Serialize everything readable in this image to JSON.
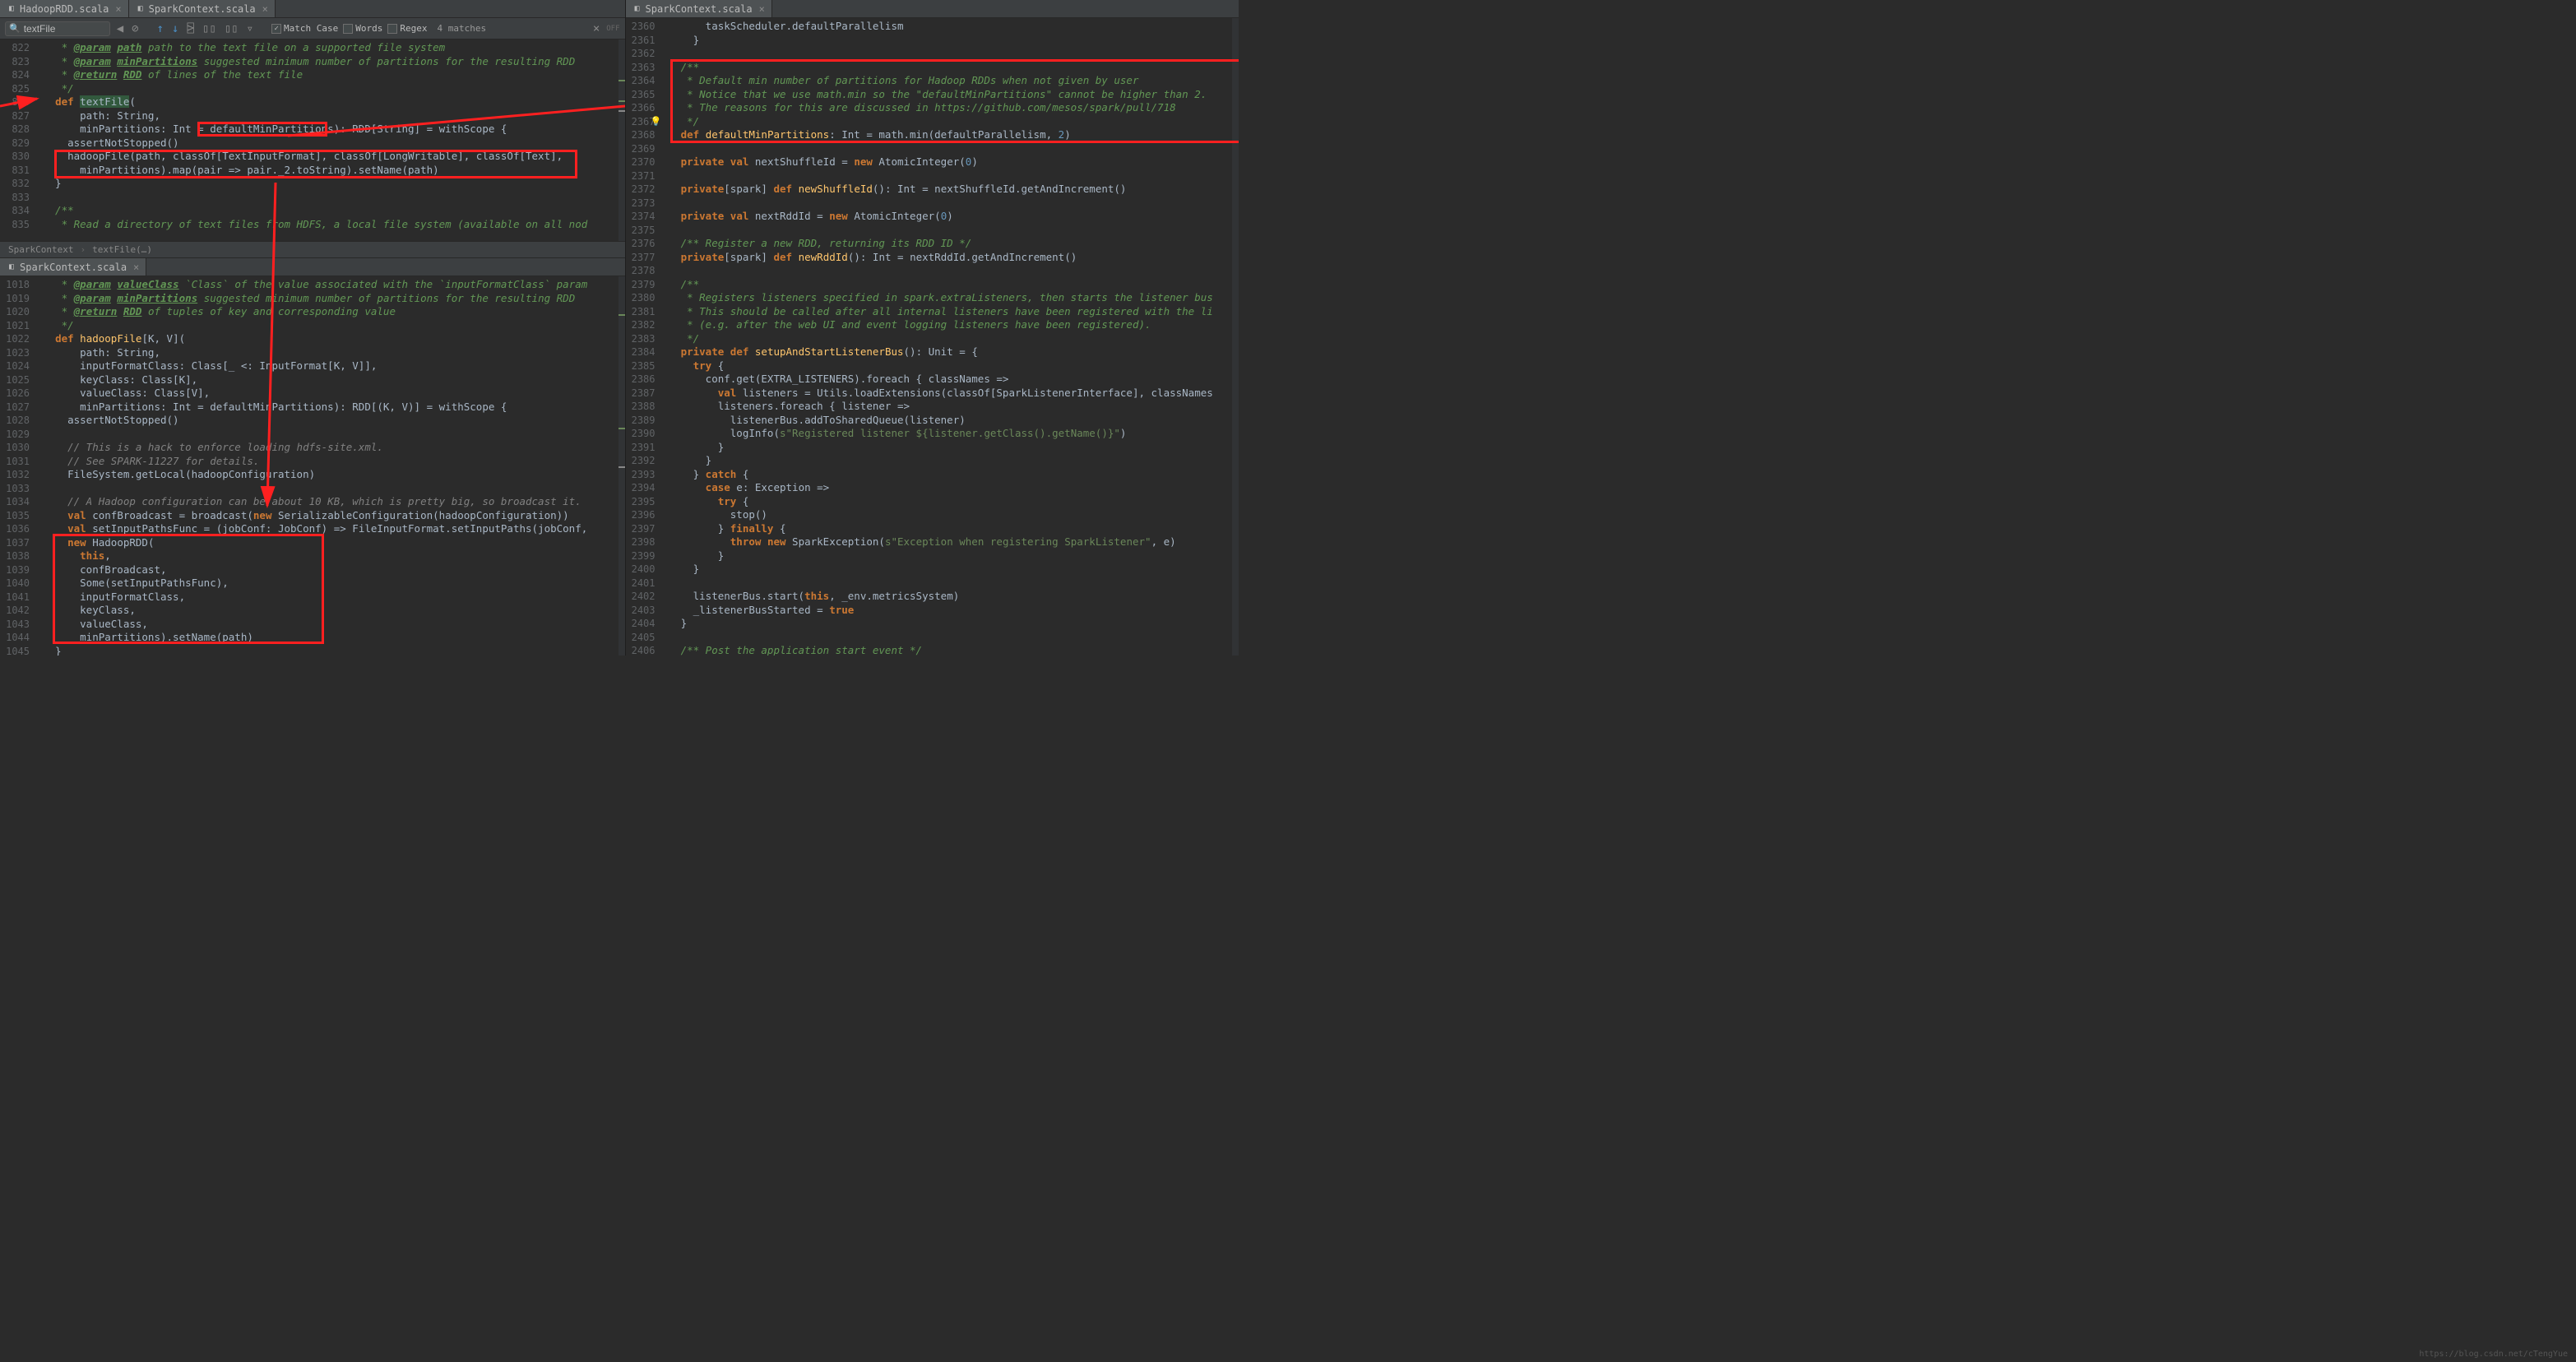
{
  "tabs_top_left": [
    {
      "name": "HadoopRDD.scala",
      "icon": "🟥"
    },
    {
      "name": "SparkContext.scala",
      "icon": "🟥"
    }
  ],
  "tabs_top_right": [
    {
      "name": "SparkContext.scala",
      "icon": "🟥"
    }
  ],
  "tabs_mid": [
    {
      "name": "SparkContext.scala",
      "icon": "🟥"
    }
  ],
  "search": {
    "query": "textFile",
    "match_case": "Match Case",
    "words": "Words",
    "regex": "Regex",
    "matches": "4 matches",
    "off": "OFF"
  },
  "breadcrumb": {
    "class": "SparkContext",
    "method": "textFile(…)"
  },
  "watermark": "https://blog.csdn.net/cTengYue",
  "p1": {
    "start": 822,
    "lines": [
      {
        "t": "doc",
        "c": "   * @param path path to the text file on a supported file system"
      },
      {
        "t": "doc",
        "c": "   * @param minPartitions suggested minimum number of partitions for the resulting RDD"
      },
      {
        "t": "doc",
        "c": "   * @return RDD of lines of the text file"
      },
      {
        "t": "doc",
        "c": "   */"
      },
      {
        "t": "code",
        "c": "  def textFile("
      },
      {
        "t": "code",
        "c": "      path: String,"
      },
      {
        "t": "code",
        "c": "      minPartitions: Int = defaultMinPartitions): RDD[String] = withScope {"
      },
      {
        "t": "code",
        "c": "    assertNotStopped()"
      },
      {
        "t": "code",
        "c": "    hadoopFile(path, classOf[TextInputFormat], classOf[LongWritable], classOf[Text],"
      },
      {
        "t": "code",
        "c": "      minPartitions).map(pair => pair._2.toString).setName(path)"
      },
      {
        "t": "code",
        "c": "  }"
      },
      {
        "t": "blank",
        "c": ""
      },
      {
        "t": "doc",
        "c": "  /**"
      },
      {
        "t": "doc",
        "c": "   * Read a directory of text files from HDFS, a local file system (available on all nod"
      }
    ]
  },
  "p2": {
    "start": 1018,
    "lines": [
      {
        "t": "doc",
        "c": "   * @param valueClass `Class` of the value associated with the `inputFormatClass` param"
      },
      {
        "t": "doc",
        "c": "   * @param minPartitions suggested minimum number of partitions for the resulting RDD"
      },
      {
        "t": "doc",
        "c": "   * @return RDD of tuples of key and corresponding value"
      },
      {
        "t": "doc",
        "c": "   */"
      },
      {
        "t": "code",
        "c": "  def hadoopFile[K, V]("
      },
      {
        "t": "code",
        "c": "      path: String,"
      },
      {
        "t": "code",
        "c": "      inputFormatClass: Class[_ <: InputFormat[K, V]],"
      },
      {
        "t": "code",
        "c": "      keyClass: Class[K],"
      },
      {
        "t": "code",
        "c": "      valueClass: Class[V],"
      },
      {
        "t": "code",
        "c": "      minPartitions: Int = defaultMinPartitions): RDD[(K, V)] = withScope {"
      },
      {
        "t": "code",
        "c": "    assertNotStopped()"
      },
      {
        "t": "blank",
        "c": ""
      },
      {
        "t": "comment",
        "c": "    // This is a hack to enforce loading hdfs-site.xml."
      },
      {
        "t": "comment",
        "c": "    // See SPARK-11227 for details."
      },
      {
        "t": "code",
        "c": "    FileSystem.getLocal(hadoopConfiguration)"
      },
      {
        "t": "blank",
        "c": ""
      },
      {
        "t": "comment",
        "c": "    // A Hadoop configuration can be about 10 KB, which is pretty big, so broadcast it."
      },
      {
        "t": "code",
        "c": "    val confBroadcast = broadcast(new SerializableConfiguration(hadoopConfiguration))"
      },
      {
        "t": "code",
        "c": "    val setInputPathsFunc = (jobConf: JobConf) => FileInputFormat.setInputPaths(jobConf,"
      },
      {
        "t": "code",
        "c": "    new HadoopRDD("
      },
      {
        "t": "code",
        "c": "      this,"
      },
      {
        "t": "code",
        "c": "      confBroadcast,"
      },
      {
        "t": "code",
        "c": "      Some(setInputPathsFunc),"
      },
      {
        "t": "code",
        "c": "      inputFormatClass,"
      },
      {
        "t": "code",
        "c": "      keyClass,"
      },
      {
        "t": "code",
        "c": "      valueClass,"
      },
      {
        "t": "code",
        "c": "      minPartitions).setName(path)"
      },
      {
        "t": "code",
        "c": "  }"
      }
    ]
  },
  "p3": {
    "start": 2360,
    "lines": [
      {
        "t": "code",
        "c": "      taskScheduler.defaultParallelism"
      },
      {
        "t": "code",
        "c": "    }"
      },
      {
        "t": "blank",
        "c": ""
      },
      {
        "t": "doc",
        "c": "  /**"
      },
      {
        "t": "doc",
        "c": "   * Default min number of partitions for Hadoop RDDs when not given by user"
      },
      {
        "t": "doc",
        "c": "   * Notice that we use math.min so the \"defaultMinPartitions\" cannot be higher than 2."
      },
      {
        "t": "doc",
        "c": "   * The reasons for this are discussed in https://github.com/mesos/spark/pull/718"
      },
      {
        "t": "doc",
        "c": "   */"
      },
      {
        "t": "code",
        "c": "  def defaultMinPartitions: Int = math.min(defaultParallelism, 2)"
      },
      {
        "t": "blank",
        "c": ""
      },
      {
        "t": "code",
        "c": "  private val nextShuffleId = new AtomicInteger(0)"
      },
      {
        "t": "blank",
        "c": ""
      },
      {
        "t": "code",
        "c": "  private[spark] def newShuffleId(): Int = nextShuffleId.getAndIncrement()"
      },
      {
        "t": "blank",
        "c": ""
      },
      {
        "t": "code",
        "c": "  private val nextRddId = new AtomicInteger(0)"
      },
      {
        "t": "blank",
        "c": ""
      },
      {
        "t": "doc",
        "c": "  /** Register a new RDD, returning its RDD ID */"
      },
      {
        "t": "code",
        "c": "  private[spark] def newRddId(): Int = nextRddId.getAndIncrement()"
      },
      {
        "t": "blank",
        "c": ""
      },
      {
        "t": "doc",
        "c": "  /**"
      },
      {
        "t": "doc",
        "c": "   * Registers listeners specified in spark.extraListeners, then starts the listener bus"
      },
      {
        "t": "doc",
        "c": "   * This should be called after all internal listeners have been registered with the li"
      },
      {
        "t": "doc",
        "c": "   * (e.g. after the web UI and event logging listeners have been registered)."
      },
      {
        "t": "doc",
        "c": "   */"
      },
      {
        "t": "code",
        "c": "  private def setupAndStartListenerBus(): Unit = {"
      },
      {
        "t": "code",
        "c": "    try {"
      },
      {
        "t": "code",
        "c": "      conf.get(EXTRA_LISTENERS).foreach { classNames =>"
      },
      {
        "t": "code",
        "c": "        val listeners = Utils.loadExtensions(classOf[SparkListenerInterface], classNames"
      },
      {
        "t": "code",
        "c": "        listeners.foreach { listener =>"
      },
      {
        "t": "code",
        "c": "          listenerBus.addToSharedQueue(listener)"
      },
      {
        "t": "code",
        "c": "          logInfo(s\"Registered listener ${listener.getClass().getName()}\")"
      },
      {
        "t": "code",
        "c": "        }"
      },
      {
        "t": "code",
        "c": "      }"
      },
      {
        "t": "code",
        "c": "    } catch {"
      },
      {
        "t": "code",
        "c": "      case e: Exception =>"
      },
      {
        "t": "code",
        "c": "        try {"
      },
      {
        "t": "code",
        "c": "          stop()"
      },
      {
        "t": "code",
        "c": "        } finally {"
      },
      {
        "t": "code",
        "c": "          throw new SparkException(s\"Exception when registering SparkListener\", e)"
      },
      {
        "t": "code",
        "c": "        }"
      },
      {
        "t": "code",
        "c": "    }"
      },
      {
        "t": "blank",
        "c": ""
      },
      {
        "t": "code",
        "c": "    listenerBus.start(this, _env.metricsSystem)"
      },
      {
        "t": "code",
        "c": "    _listenerBusStarted = true"
      },
      {
        "t": "code",
        "c": "  }"
      },
      {
        "t": "blank",
        "c": ""
      },
      {
        "t": "doc",
        "c": "  /** Post the application start event */"
      }
    ]
  },
  "chart_data": null
}
